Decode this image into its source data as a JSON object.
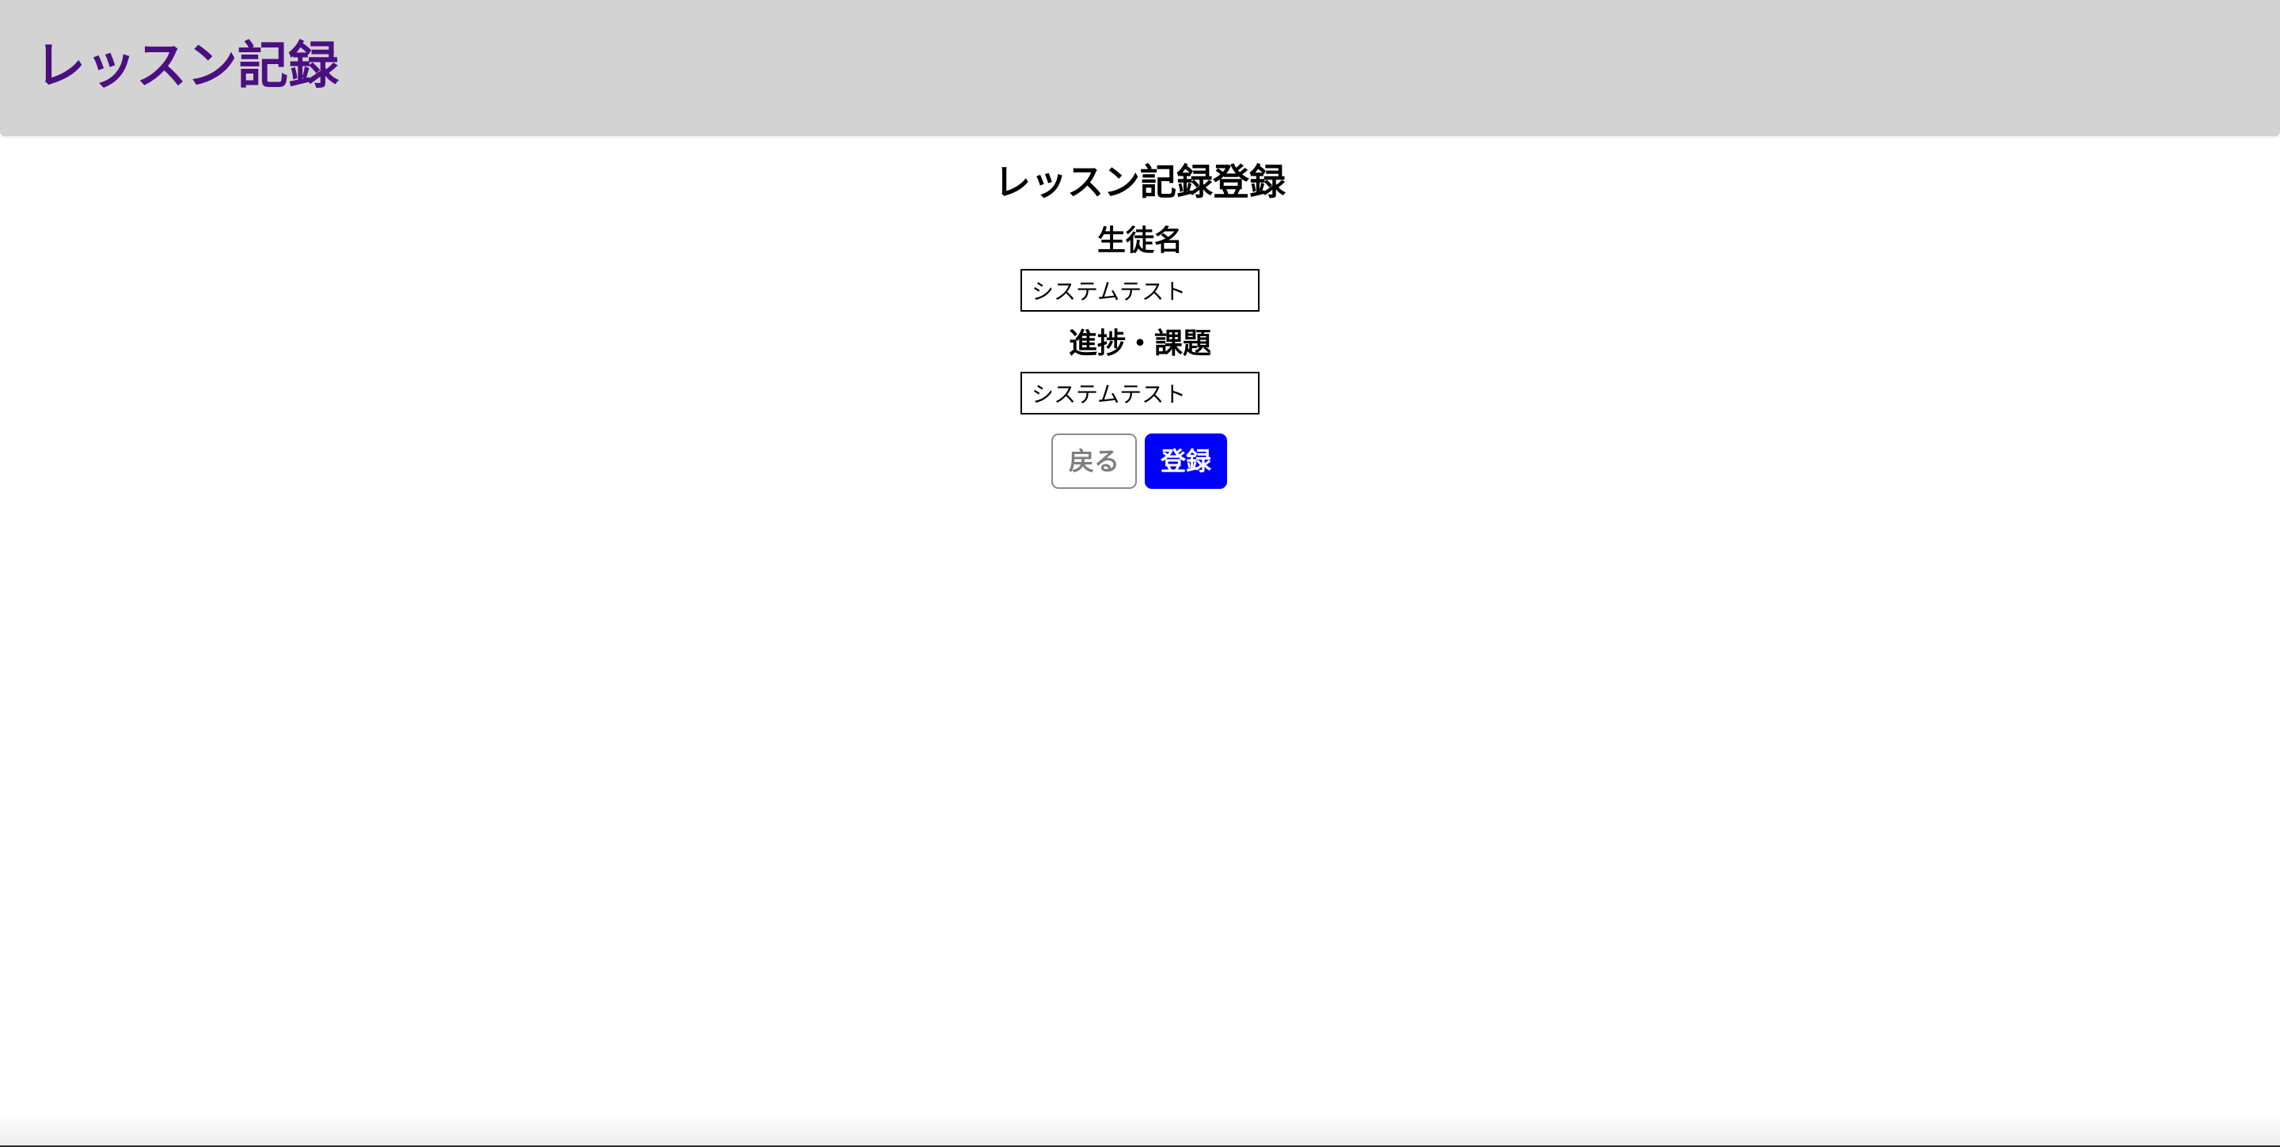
{
  "header": {
    "title": "レッスン記録"
  },
  "form": {
    "heading": "レッスン記録登録",
    "student_name": {
      "label": "生徒名",
      "value": "システムテスト"
    },
    "progress_tasks": {
      "label": "進捗・課題",
      "value": "システムテスト"
    },
    "back_label": "戻る",
    "register_label": "登録"
  },
  "colors": {
    "header_bg": "#d3d3d3",
    "title": "#4b0f82",
    "register_button": "#0000ff"
  }
}
